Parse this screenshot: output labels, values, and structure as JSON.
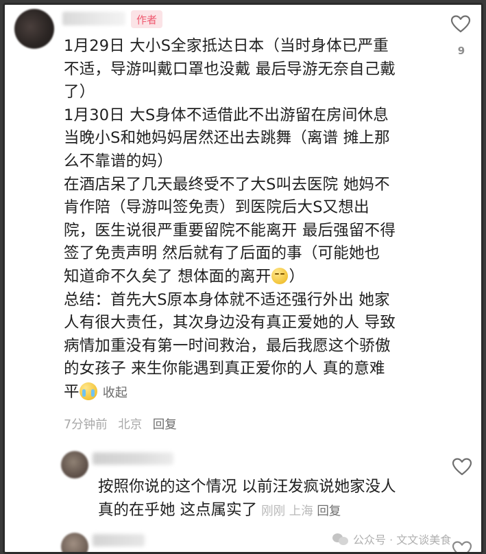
{
  "comment": {
    "author_badge": "作者",
    "lines": [
      "1月29日 大小S全家抵达日本（当时身体已严重",
      "不适，导游叫戴口罩也没戴 最后导游无奈自己戴",
      "了）",
      "1月30日 大S身体不适借此不出游留在房间休息",
      "当晚小S和她妈妈居然还出去跳舞（离谱 摊上那",
      "么不靠谱的妈）",
      "在酒店呆了几天最终受不了大S叫去医院 她妈不",
      "肯作陪（导游叫签免责）到医院后大S又想出",
      "院，医生说很严重要留院不能离开 最后强留不得",
      "签了免责声明 然后就有了后面的事（可能她也",
      "知道命不久矣了 想体面的离开",
      "总结：首先大S原本身体就不适还强行外出 她家",
      "人有很大责任，其次身边没有真正爱她的人 导致",
      "病情加重没有第一时间救治，最后我愿这个骄傲",
      "的女孩子 来生你能遇到真正爱你的人 真的意难",
      "平"
    ],
    "line_11_suffix": "）",
    "collapse_label": "收起",
    "time": "7分钟前",
    "location": "北京",
    "reply_label": "回复",
    "like_count": "9",
    "icons": {
      "like": "heart-outline-icon",
      "emoji_sad": "pensive-emoji-icon",
      "emoji_cry": "crying-emoji-icon"
    }
  },
  "replies": [
    {
      "lines": [
        "按照你说的这个情况 以前汪发疯说她家没人",
        "真的在乎她 这点属实了"
      ],
      "time": "刚刚",
      "location": "上海",
      "reply_label": "回复"
    }
  ],
  "watermark": {
    "text": "公众号 · 文文谈美食"
  },
  "colors": {
    "author_badge_bg": "#fbe3e6",
    "author_badge_text": "#ef5a70",
    "meta_text": "#a8a8a8",
    "body_text": "#1f1f1f"
  }
}
